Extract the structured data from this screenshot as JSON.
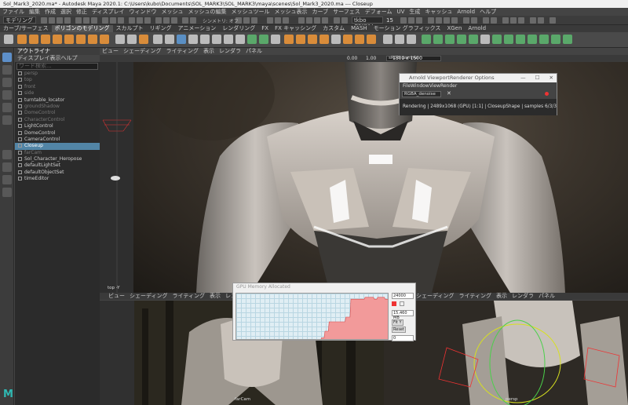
{
  "window": {
    "title": "Sol_Mark3_2020.ma* - Autodesk Maya 2020.1: C:\\Users\\kubo\\Documents\\SOL_MARK3\\SOL_MARK3\\maya\\scenes\\Sol_Mark3_2020.ma  ---  Closeup"
  },
  "menubar": [
    "ファイル",
    "編集",
    "作成",
    "選択",
    "修正",
    "ディスプレイ",
    "ウィンドウ",
    "メッシュ",
    "メッシュの編集",
    "メッシュツール",
    "メッシュ表示",
    "カーブ",
    "サーフェス",
    "デフォーム",
    "UV",
    "生成",
    "キャッシュ",
    "Arnold",
    "ヘルプ"
  ],
  "status": {
    "mode": "モデリング",
    "symmetry": "シンメトリ: オフ",
    "camera": "tkbo C3KNV",
    "frame": "15"
  },
  "shelf_tabs": [
    "カーブ/サーフェス",
    "ポリゴンのモデリング",
    "スカルプト",
    "リギング",
    "アニメーション",
    "レンダリング",
    "FX",
    "FX キャッシング",
    "カスタム",
    "MASH",
    "モーション グラフィックス",
    "XGen",
    "Arnold"
  ],
  "shelf_active": 1,
  "outliner": {
    "title": "アウトライナ",
    "menu": [
      "ディスプレイ",
      "表示",
      "ヘルプ"
    ],
    "search_placeholder": "ワード検索...",
    "items": [
      {
        "label": "persp",
        "dim": true
      },
      {
        "label": "top",
        "dim": true
      },
      {
        "label": "front",
        "dim": true
      },
      {
        "label": "side",
        "dim": true
      },
      {
        "label": "turntable_locator",
        "dim": false
      },
      {
        "label": "groundShadow",
        "dim": true
      },
      {
        "label": "DomeControl",
        "dim": true
      },
      {
        "label": "CharacterControl",
        "dim": true
      },
      {
        "label": "LightControl",
        "dim": false
      },
      {
        "label": "DomeControl",
        "dim": false
      },
      {
        "label": "CameraControl",
        "dim": false
      },
      {
        "label": "Closeup",
        "dim": false,
        "selected": true
      },
      {
        "label": "farCam",
        "dim": true
      },
      {
        "label": "Sol_Character_Heropose",
        "dim": false
      },
      {
        "label": "defaultLightSet",
        "dim": false
      },
      {
        "label": "defaultObjectSet",
        "dim": false
      },
      {
        "label": "timeEditor",
        "dim": false
      }
    ]
  },
  "viewport_menu": [
    "ビュー",
    "シェーディング",
    "ライティング",
    "表示",
    "レンダラ",
    "パネル"
  ],
  "viewport": {
    "exposure": "0.00",
    "gamma_value": "1.00",
    "gamma": "sRGB gamma",
    "resolution": "1500 x 1500",
    "left_label": "top -Y"
  },
  "arnold": {
    "title": "Arnold ViewportRenderer Options",
    "menu": [
      "File",
      "Window",
      "View",
      "Render"
    ],
    "aov": "RGBA_denoise",
    "status": "Rendering  |  2489x1068  (GPU) [1:1]  |  CloseupShape  |  samples 6/3/3/1/1/1"
  },
  "gpu": {
    "title": "GPU Memory Allocated",
    "max": "24000",
    "current": "15,460 MB",
    "fit": "Fit Y",
    "reset": "Reset",
    "min": "0",
    "series": [
      2,
      2,
      2,
      2,
      2,
      2,
      2,
      2,
      2,
      2,
      2,
      2,
      2,
      2,
      2,
      2,
      2,
      2,
      2,
      2,
      2,
      2,
      2,
      2,
      2,
      2,
      2,
      2,
      2,
      2,
      2,
      2,
      2,
      2,
      2,
      2,
      2,
      2,
      2,
      2,
      2,
      2,
      2,
      2,
      2,
      2,
      2,
      2,
      2,
      2,
      2,
      2,
      2,
      2,
      2,
      2,
      2,
      2,
      2,
      2,
      2,
      2,
      2,
      2,
      2,
      2,
      2,
      2,
      2,
      2,
      2,
      2,
      2,
      2,
      2,
      2,
      2,
      2,
      2,
      2,
      2,
      2,
      2,
      2,
      2,
      2,
      2,
      2,
      2,
      2,
      2,
      2,
      2,
      2,
      2,
      2,
      2,
      2,
      2,
      2,
      2,
      2,
      6,
      6,
      6,
      6,
      20,
      20,
      20,
      20,
      20,
      40,
      40,
      40,
      40,
      40,
      40,
      40,
      40,
      40,
      40,
      40,
      40,
      40,
      40,
      40,
      40,
      40,
      40,
      40,
      40,
      50,
      50,
      50,
      50,
      50,
      50,
      88,
      88,
      88,
      88,
      88,
      88,
      88,
      88,
      88,
      88,
      88,
      88,
      88,
      88,
      88,
      88,
      88,
      92,
      92,
      92,
      92,
      92,
      92,
      92,
      92,
      92,
      92,
      92,
      88,
      88,
      88,
      88,
      92,
      92,
      92,
      92,
      92,
      92,
      92,
      92,
      92,
      88,
      88,
      88,
      88,
      88,
      88
    ]
  },
  "bottom_views": [
    {
      "label": "",
      "menu": [
        "ビュー",
        "シェーディング",
        "ライティング",
        "表示",
        "レンダラ",
        "パネル"
      ]
    },
    {
      "label": "farCam",
      "menu": []
    },
    {
      "label": "persp",
      "menu": [
        "ビュー",
        "シェーディング",
        "ライティング",
        "表示",
        "レンダラ",
        "パネル"
      ]
    }
  ]
}
